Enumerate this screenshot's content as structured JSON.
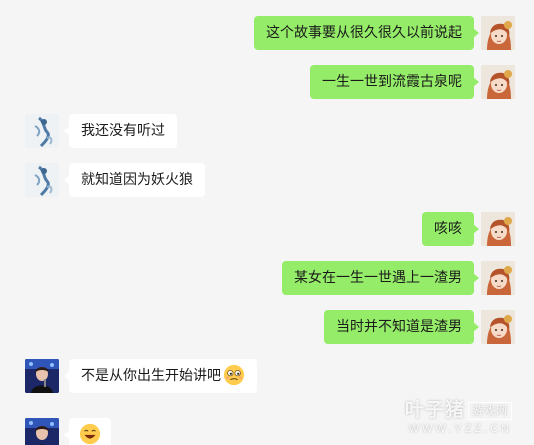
{
  "messages": [
    {
      "side": "right",
      "avatar": "girl-avatar",
      "text": "这个故事要从很久很久以前说起"
    },
    {
      "side": "right",
      "avatar": "girl-avatar",
      "text": "一生一世到流霞古泉呢"
    },
    {
      "side": "left",
      "avatar": "ink-avatar",
      "text": "我还没有听过"
    },
    {
      "side": "left",
      "avatar": "ink-avatar",
      "text": "就知道因为妖火狼"
    },
    {
      "side": "right",
      "avatar": "girl-avatar",
      "text": "咳咳"
    },
    {
      "side": "right",
      "avatar": "girl-avatar",
      "text": "某女在一生一世遇上一渣男"
    },
    {
      "side": "right",
      "avatar": "girl-avatar",
      "text": "当时并不知道是渣男"
    },
    {
      "side": "left",
      "avatar": "stage-avatar",
      "text": "不是从你出生开始讲吧",
      "emoji": "smirk-emoji"
    },
    {
      "side": "left",
      "avatar": "stage-avatar",
      "text": "",
      "emoji": "laugh-emoji"
    }
  ],
  "watermark": {
    "brand": "叶子猪",
    "tag": "游戏网",
    "url": "WWW.YZZ.CN"
  },
  "colors": {
    "background": "#f5f5f5",
    "outgoing_bubble": "#95ec69",
    "incoming_bubble": "#ffffff"
  }
}
